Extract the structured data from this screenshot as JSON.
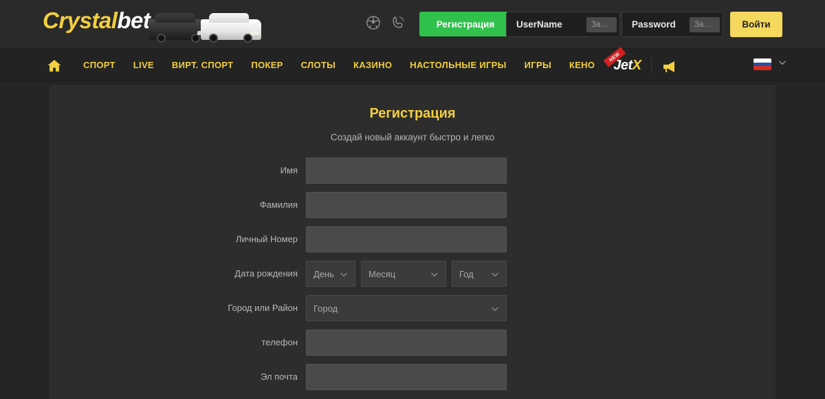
{
  "header": {
    "logo": {
      "part1": "Crystal",
      "part2": "bet"
    },
    "icons": [
      {
        "name": "soccer-ball-icon",
        "label": "soccer-ball-icon"
      },
      {
        "name": "phone-icon",
        "label": "phone-icon"
      }
    ],
    "register_button": "Регистрация",
    "username_field": {
      "label": "UserName",
      "forgot": "Забыли",
      "value": ""
    },
    "password_field": {
      "label": "Password",
      "forgot": "Забыли",
      "value": ""
    },
    "login_button": "Войти",
    "colors": {
      "register_green": "#2fc14c",
      "login_yellow": "#f5d95e",
      "brand_yellow": "#f2cf3f",
      "header_bg": "#2a2a2a"
    }
  },
  "nav": {
    "home_icon": "home-icon",
    "items": [
      {
        "label": "СПОРТ"
      },
      {
        "label": "LIVE"
      },
      {
        "label": "ВИРТ. СПОРТ"
      },
      {
        "label": "ПОКЕР"
      },
      {
        "label": "СЛОТЫ"
      },
      {
        "label": "КАЗИНО"
      },
      {
        "label": "НАСТОЛЬНЫЕ ИГРЫ"
      },
      {
        "label": "ИГРЫ"
      },
      {
        "label": "КЕНО"
      }
    ],
    "jetx": {
      "jet": "Jet",
      "x": "X",
      "badge": "NEW"
    },
    "megaphone_icon": "megaphone-icon",
    "language": {
      "flag": "ru-flag-icon",
      "chevron": "chevron-down-icon"
    }
  },
  "registration": {
    "title": "Регистрация",
    "subtitle": "Создай новый аккаунт быстро и легко",
    "fields": [
      {
        "label": "Имя",
        "type": "text",
        "value": "",
        "placeholder": ""
      },
      {
        "label": "Фамилия",
        "type": "text",
        "value": "",
        "placeholder": ""
      },
      {
        "label": "Личный Номер",
        "type": "text",
        "value": "",
        "placeholder": ""
      }
    ],
    "dob": {
      "label": "Дата рождения",
      "day": "День",
      "month": "Месяц",
      "year": "Год"
    },
    "city": {
      "label": "Город или Район",
      "value": "Город"
    },
    "contact": [
      {
        "label": "телефон",
        "type": "text",
        "value": "",
        "placeholder": ""
      },
      {
        "label": "Эл почта",
        "type": "text",
        "value": "",
        "placeholder": ""
      }
    ]
  }
}
